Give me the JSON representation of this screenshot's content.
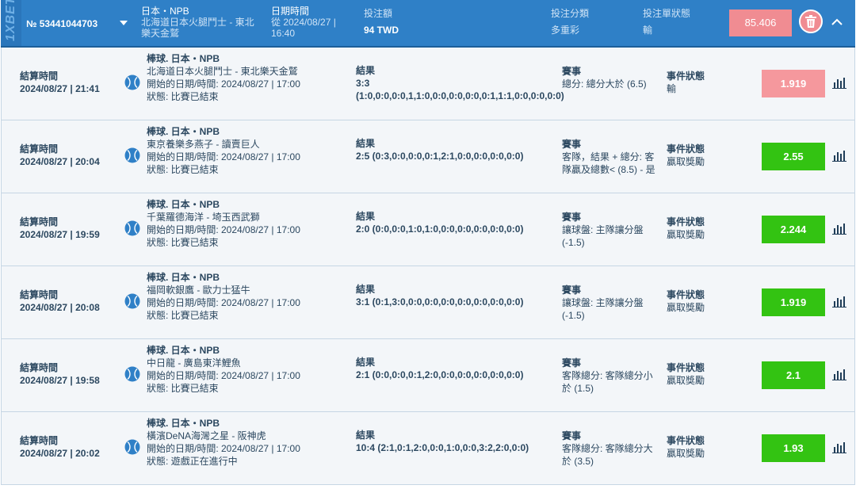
{
  "header": {
    "logo": "1XBET",
    "bet_number": "№ 53441044703",
    "match_title": "日本・NPB",
    "match_desc": "北海道日本火腿鬥士 - 東北樂天金鷲",
    "date_title": "日期時間",
    "date_value": "從 2024/08/27 | 16:40",
    "stake_label": "投注額",
    "stake_value": "94 TWD",
    "type_label": "投注分類",
    "type_value": "多重彩",
    "status_label": "投注單狀態",
    "status_value": "輸",
    "total_odds": "85.406",
    "colors": {
      "header_bg": "#2f80c7",
      "lose": "#f5989d",
      "win": "#33c312"
    }
  },
  "rows": [
    {
      "settle_label": "結算時間",
      "settle_time": "2024/08/27 | 21:41",
      "league": "棒球. 日本・NPB",
      "teams": "北海道日本火腿鬥士 - 東北樂天金鷲",
      "start": "開始的日期/時間: 2024/08/27 | 17:00",
      "state": "狀態: 比賽已結束",
      "result_label": "結果",
      "result": "3:3 (1:0,0:0,0:0,1,1:0,0:0,0:0,0:0,0:1,1:1,0:0,0:0,0:0)",
      "market_label": "賽事",
      "market": "總分: 總分大於 (6.5)",
      "ev_label": "事件狀態",
      "ev_status": "輸",
      "odds": "1.919",
      "outcome": "lose"
    },
    {
      "settle_label": "結算時間",
      "settle_time": "2024/08/27 | 20:04",
      "league": "棒球. 日本・NPB",
      "teams": "東京養樂多燕子 - 讀賣巨人",
      "start": "開始的日期/時間: 2024/08/27 | 17:00",
      "state": "狀態: 比賽已結束",
      "result_label": "結果",
      "result": "2:5 (0:3,0:0,0:0,0:1,2:1,0:0,0:0,0:0,0:0)",
      "market_label": "賽事",
      "market": "客隊，結果 + 總分: 客隊贏及總數< (8.5) - 是",
      "ev_label": "事件狀態",
      "ev_status": "贏取獎勵",
      "odds": "2.55",
      "outcome": "win"
    },
    {
      "settle_label": "結算時間",
      "settle_time": "2024/08/27 | 19:59",
      "league": "棒球. 日本・NPB",
      "teams": "千葉羅德海洋 - 埼玉西武獅",
      "start": "開始的日期/時間: 2024/08/27 | 17:00",
      "state": "狀態: 比賽已結束",
      "result_label": "結果",
      "result": "2:0 (0:0,0:0,1:0,1:0,0:0,0:0,0:0,0:0,0:0)",
      "market_label": "賽事",
      "market": "讓球盤: 主隊讓分盤 (-1.5)",
      "ev_label": "事件狀態",
      "ev_status": "贏取獎勵",
      "odds": "2.244",
      "outcome": "win"
    },
    {
      "settle_label": "結算時間",
      "settle_time": "2024/08/27 | 20:08",
      "league": "棒球. 日本・NPB",
      "teams": "福岡軟銀鷹 - 歐力士猛牛",
      "start": "開始的日期/時間: 2024/08/27 | 17:00",
      "state": "狀態: 比賽已結束",
      "result_label": "結果",
      "result": "3:1 (0:1,3:0,0:0,0:0,0:0,0:0,0:0,0:0,0:0)",
      "market_label": "賽事",
      "market": "讓球盤: 主隊讓分盤 (-1.5)",
      "ev_label": "事件狀態",
      "ev_status": "贏取獎勵",
      "odds": "1.919",
      "outcome": "win"
    },
    {
      "settle_label": "結算時間",
      "settle_time": "2024/08/27 | 19:58",
      "league": "棒球. 日本・NPB",
      "teams": "中日龍 - 廣島東洋鯉魚",
      "start": "開始的日期/時間: 2024/08/27 | 17:00",
      "state": "狀態: 比賽已結束",
      "result_label": "結果",
      "result": "2:1 (0:0,0:0,0:1,2:0,0:0,0:0,0:0,0:0,0:0)",
      "market_label": "賽事",
      "market": "客隊總分: 客隊總分小於 (1.5)",
      "ev_label": "事件狀態",
      "ev_status": "贏取獎勵",
      "odds": "2.1",
      "outcome": "win"
    },
    {
      "settle_label": "結算時間",
      "settle_time": "2024/08/27 | 20:02",
      "league": "棒球. 日本・NPB",
      "teams": "橫濱DeNA海灣之星 - 阪神虎",
      "start": "開始的日期/時間: 2024/08/27 | 17:00",
      "state": "狀態: 遊戲正在進行中",
      "result_label": "結果",
      "result": "10:4 (2:1,0:1,2:0,0:0,1:0,0:0,3:2,2:0,0:0)",
      "market_label": "賽事",
      "market": "客隊總分: 客隊總分大於 (3.5)",
      "ev_label": "事件狀態",
      "ev_status": "贏取獎勵",
      "odds": "1.93",
      "outcome": "win"
    }
  ]
}
